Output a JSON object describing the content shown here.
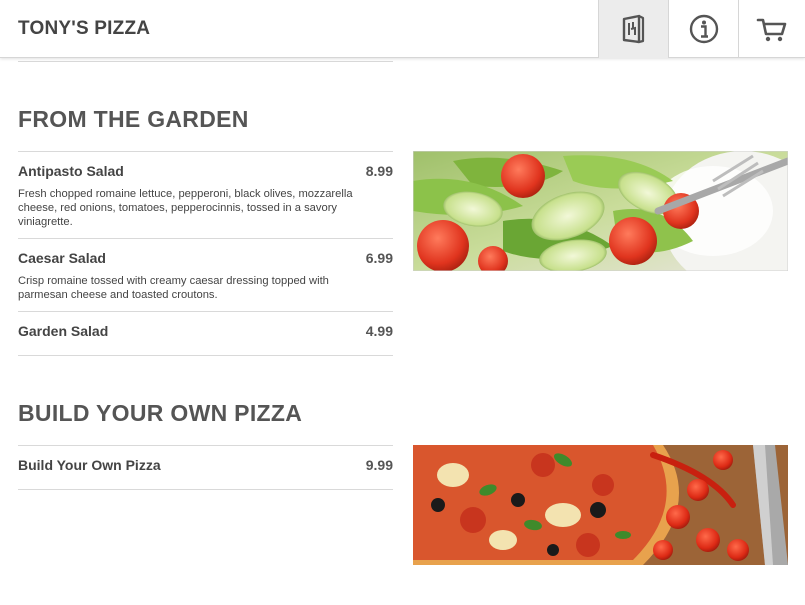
{
  "header": {
    "brand": "TONY'S PIZZA",
    "nav": [
      {
        "icon": "menu-book-icon",
        "active": true
      },
      {
        "icon": "info-icon",
        "active": false
      },
      {
        "icon": "cart-icon",
        "active": false
      }
    ]
  },
  "sections": [
    {
      "title": "FROM THE GARDEN",
      "items": [
        {
          "name": "Antipasto Salad",
          "price": "8.99",
          "description": "Fresh chopped romaine lettuce, pepperoni, black olives, mozzarella cheese, red onions, tomatoes, pepperocinnis, tossed in a savory viniagrette."
        },
        {
          "name": "Caesar Salad",
          "price": "6.99",
          "description": "Crisp romaine tossed with creamy caesar dressing topped with parmesan cheese and toasted croutons."
        },
        {
          "name": "Garden Salad",
          "price": "4.99",
          "description": ""
        }
      ],
      "image": "salad-photo"
    },
    {
      "title": "BUILD YOUR OWN PIZZA",
      "items": [
        {
          "name": "Build Your Own Pizza",
          "price": "9.99",
          "description": ""
        }
      ],
      "image": "pizza-photo"
    }
  ],
  "colors": {
    "text": "#444444",
    "divider": "#d9d9d9",
    "active_nav": "#ececec"
  }
}
